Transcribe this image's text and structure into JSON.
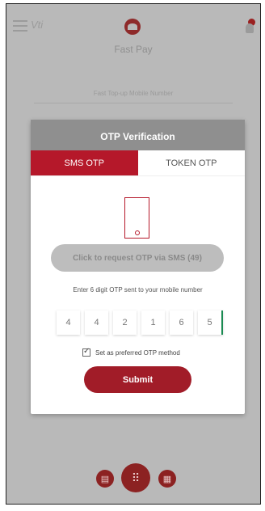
{
  "appbar": {
    "brand": "Vti",
    "title": "Fast Pay"
  },
  "form": {
    "topup_label": "Fast Top-up Mobile Number"
  },
  "bottom_nav": {
    "left_icon": "document-icon",
    "center_icon": "grid-icon",
    "right_icon": "menu-icon"
  },
  "otp_modal": {
    "title": "OTP Verification",
    "tabs": [
      {
        "label": "SMS OTP",
        "active": true
      },
      {
        "label": "TOKEN OTP",
        "active": false
      }
    ],
    "request_button": "Click to request OTP via SMS (49)",
    "instruction": "Enter 6 digit OTP sent to your mobile number",
    "digits": [
      "4",
      "4",
      "2",
      "1",
      "6",
      "5"
    ],
    "preferred_label": "Set as preferred OTP method",
    "preferred_checked": true,
    "submit_label": "Submit"
  },
  "colors": {
    "accent": "#b5182a",
    "overlay": "#b9b9b9"
  }
}
